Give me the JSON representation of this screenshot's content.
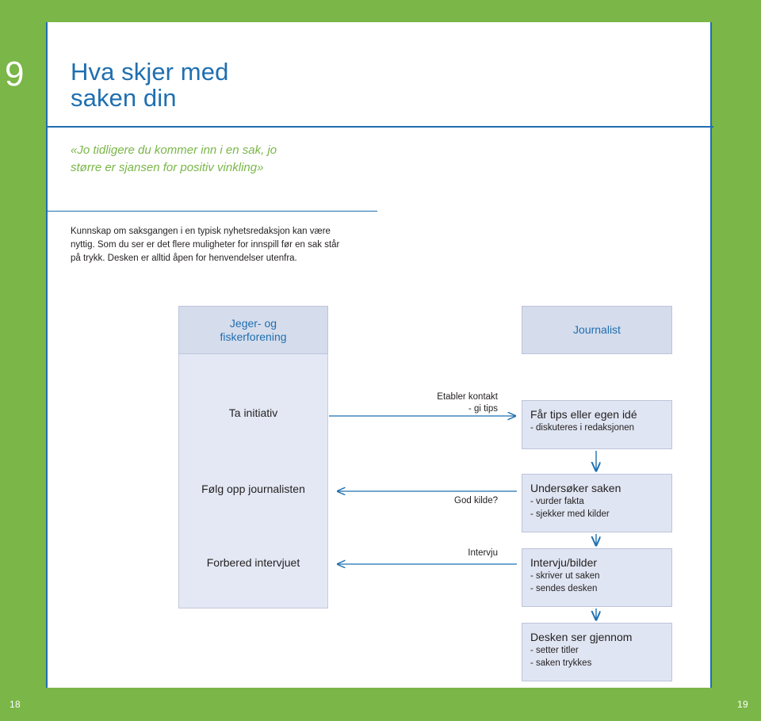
{
  "page": {
    "chapter_number": "9",
    "page_number_left": "18",
    "page_number_right": "19",
    "accent_green": "#7ab648",
    "accent_blue": "#1f6fb0"
  },
  "header": {
    "title_line1": "Hva skjer med",
    "title_line2": "saken din",
    "subtitle_line1": "«Jo tidligere du kommer inn i en sak, jo",
    "subtitle_line2": "større er sjansen for positiv vinkling»"
  },
  "intro": {
    "text": "Kunnskap om saksgangen i en typisk nyhetsredaksjon kan være nyttig. Som du ser er det flere muligheter for innspill før en sak står på trykk. Desken er alltid åpen for henvendelser utenfra."
  },
  "diagram": {
    "lane_left_header": "Jeger- og\nfiskerforening",
    "lane_left_header_l1": "Jeger- og",
    "lane_left_header_l2": "fiskerforening",
    "lane_right_header": "Journalist",
    "left_steps": [
      {
        "label": "Ta initiativ"
      },
      {
        "label": "Følg opp journalisten"
      },
      {
        "label": "Forbered intervjuet"
      }
    ],
    "arrow_labels": [
      {
        "line1": "Etabler kontakt",
        "line2": "- gi tips"
      },
      {
        "line1": "God kilde?",
        "line2": ""
      },
      {
        "line1": "Intervju",
        "line2": ""
      }
    ],
    "right_steps": [
      {
        "title": "Får tips eller egen idé",
        "details": [
          "- diskuteres i redaksjonen"
        ]
      },
      {
        "title": "Undersøker saken",
        "details": [
          "- vurder fakta",
          "- sjekker med kilder"
        ]
      },
      {
        "title": "Intervju/bilder",
        "details": [
          "- skriver ut saken",
          "- sendes desken"
        ]
      },
      {
        "title": "Desken ser gjennom",
        "details": [
          "- setter titler",
          "- saken trykkes"
        ]
      }
    ]
  }
}
